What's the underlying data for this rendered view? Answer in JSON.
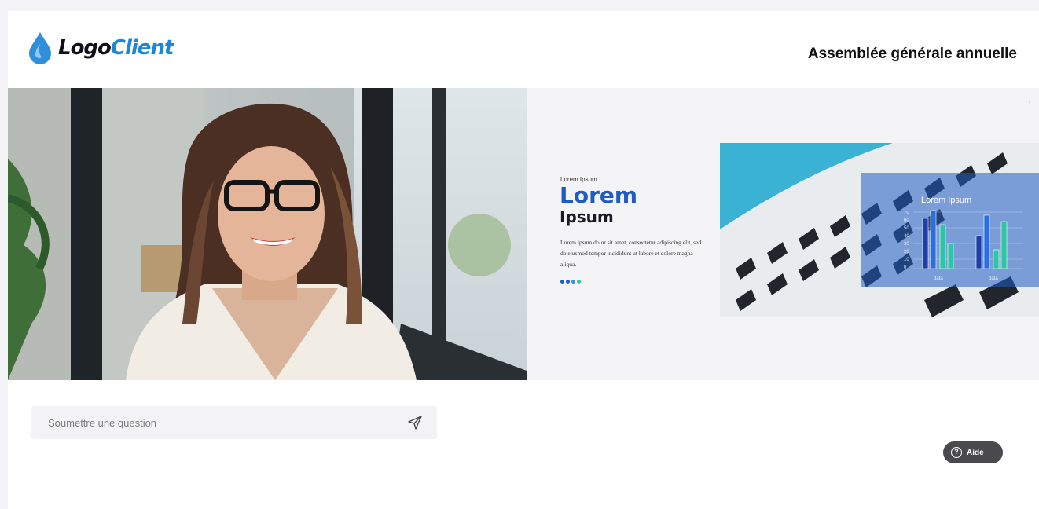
{
  "header": {
    "logo_part1": "Logo",
    "logo_part2": "Client",
    "event_title": "Assemblée générale annuelle"
  },
  "slide": {
    "page_number": "1",
    "kicker": "Lorem Ipsum",
    "headline_1": "Lorem",
    "headline_2": "Ipsum",
    "body": "Lorem ipsum dolor sit amet, consectetur adipiscing elit, sed do eiusmod tempor incididunt ut labore et dolore magna aliqua.",
    "dot_colors": [
      "#1f5bc4",
      "#1f5bc4",
      "#3a8fd6",
      "#2fc4a4"
    ],
    "chart_title": "Lorem Ipsum",
    "chart_yticks": [
      "70",
      "60",
      "50",
      "40",
      "30",
      "20",
      "10",
      "0"
    ],
    "chart_xlabels": [
      "data",
      "data"
    ]
  },
  "question": {
    "placeholder": "Soumettre une question",
    "send_icon": "send-icon"
  },
  "help": {
    "label": "Aide",
    "icon": "question-icon"
  },
  "colors": {
    "brand_blue": "#1d86d6",
    "accent_blue": "#1f5bc4",
    "help_bg": "#4a4a4c"
  }
}
